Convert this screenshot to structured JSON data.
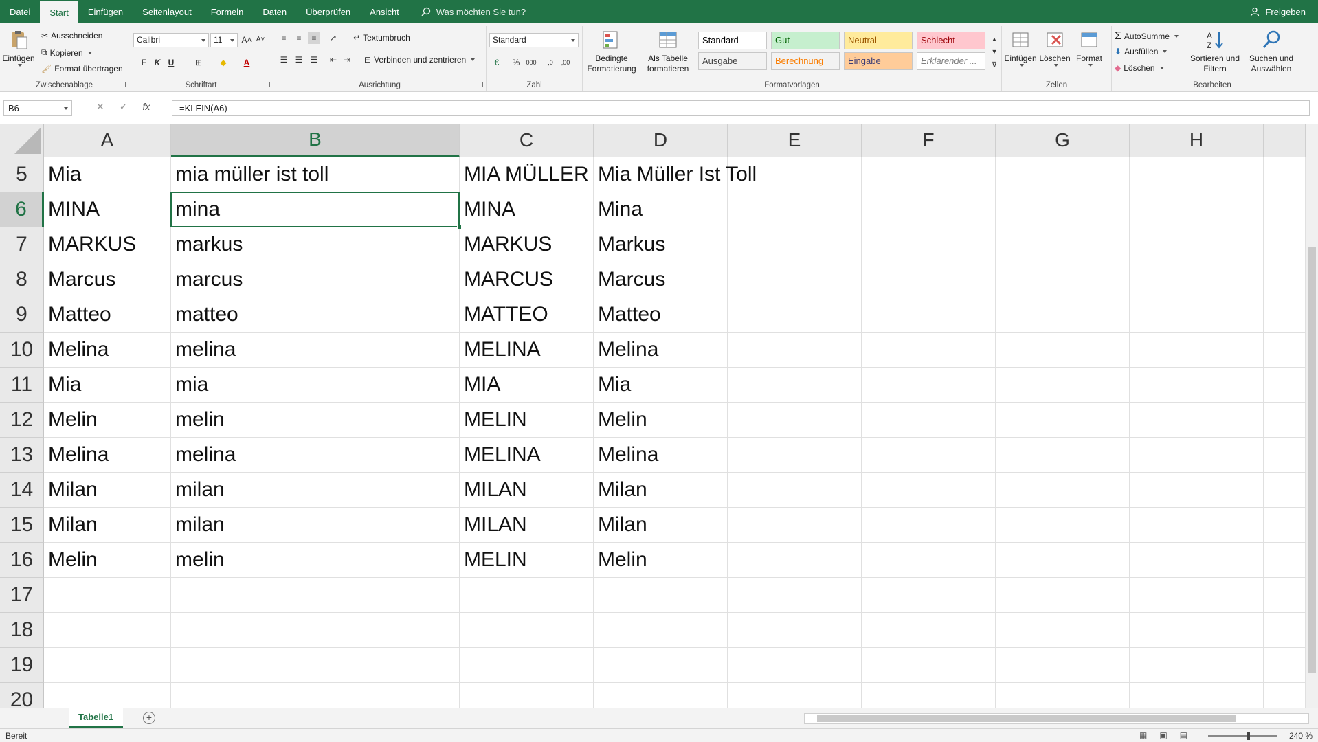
{
  "menu": {
    "tabs": [
      "Datei",
      "Start",
      "Einfügen",
      "Seitenlayout",
      "Formeln",
      "Daten",
      "Überprüfen",
      "Ansicht"
    ],
    "active_tab": "Start",
    "tell_me": "Was möchten Sie tun?",
    "share": "Freigeben"
  },
  "ribbon": {
    "clipboard": {
      "paste": "Einfügen",
      "cut": "Ausschneiden",
      "copy": "Kopieren",
      "format_painter": "Format übertragen",
      "label": "Zwischenablage"
    },
    "font": {
      "name": "Calibri",
      "size": "11",
      "bold": "F",
      "italic": "K",
      "underline": "U",
      "label": "Schriftart"
    },
    "alignment": {
      "wrap": "Textumbruch",
      "merge": "Verbinden und zentrieren",
      "label": "Ausrichtung"
    },
    "number": {
      "format": "Standard",
      "label": "Zahl"
    },
    "styles": {
      "conditional": "Bedingte Formatierung",
      "as_table": "Als Tabelle formatieren",
      "cells": [
        {
          "label": "Standard",
          "bg": "#ffffff",
          "fg": "#000000"
        },
        {
          "label": "Gut",
          "bg": "#c6efce",
          "fg": "#006100"
        },
        {
          "label": "Neutral",
          "bg": "#ffeb9c",
          "fg": "#9c5700"
        },
        {
          "label": "Schlecht",
          "bg": "#ffc7ce",
          "fg": "#9c0006"
        },
        {
          "label": "Ausgabe",
          "bg": "#f2f2f2",
          "fg": "#3f3f3f"
        },
        {
          "label": "Berechnung",
          "bg": "#f2f2f2",
          "fg": "#fa7d00"
        },
        {
          "label": "Eingabe",
          "bg": "#ffcc99",
          "fg": "#3f3f76"
        },
        {
          "label": "Erklärender ...",
          "bg": "#ffffff",
          "fg": "#7f7f7f"
        }
      ],
      "label": "Formatvorlagen"
    },
    "cells_group": {
      "insert": "Einfügen",
      "delete": "Löschen",
      "format": "Format",
      "label": "Zellen"
    },
    "editing": {
      "autosum": "AutoSumme",
      "fill": "Ausfüllen",
      "clear": "Löschen",
      "sort": "Sortieren und Filtern",
      "find": "Suchen und Auswählen",
      "label": "Bearbeiten"
    }
  },
  "formula_bar": {
    "name_box": "B6",
    "formula": "=KLEIN(A6)"
  },
  "grid": {
    "columns": [
      "A",
      "B",
      "C",
      "D",
      "E",
      "F",
      "G",
      "H"
    ],
    "selected_column": "B",
    "selected_row": "6",
    "rows": [
      {
        "num": "5",
        "cells": [
          "Mia",
          "mia müller ist toll",
          "MIA MÜLLER",
          "Mia Müller Ist Toll",
          "",
          "",
          "",
          ""
        ]
      },
      {
        "num": "6",
        "cells": [
          "MINA",
          "mina",
          "MINA",
          "Mina",
          "",
          "",
          "",
          ""
        ]
      },
      {
        "num": "7",
        "cells": [
          "MARKUS",
          "markus",
          "MARKUS",
          "Markus",
          "",
          "",
          "",
          ""
        ]
      },
      {
        "num": "8",
        "cells": [
          "Marcus",
          "marcus",
          "MARCUS",
          "Marcus",
          "",
          "",
          "",
          ""
        ]
      },
      {
        "num": "9",
        "cells": [
          "Matteo",
          "matteo",
          "MATTEO",
          "Matteo",
          "",
          "",
          "",
          ""
        ]
      },
      {
        "num": "10",
        "cells": [
          "Melina",
          "melina",
          "MELINA",
          "Melina",
          "",
          "",
          "",
          ""
        ]
      },
      {
        "num": "11",
        "cells": [
          "Mia",
          "mia",
          "MIA",
          "Mia",
          "",
          "",
          "",
          ""
        ]
      },
      {
        "num": "12",
        "cells": [
          "Melin",
          "melin",
          "MELIN",
          "Melin",
          "",
          "",
          "",
          ""
        ]
      },
      {
        "num": "13",
        "cells": [
          "Melina",
          "melina",
          "MELINA",
          "Melina",
          "",
          "",
          "",
          ""
        ]
      },
      {
        "num": "14",
        "cells": [
          "Milan",
          "milan",
          "MILAN",
          "Milan",
          "",
          "",
          "",
          ""
        ]
      },
      {
        "num": "15",
        "cells": [
          "Milan",
          "milan",
          "MILAN",
          "Milan",
          "",
          "",
          "",
          ""
        ]
      },
      {
        "num": "16",
        "cells": [
          "Melin",
          "melin",
          "MELIN",
          "Melin",
          "",
          "",
          "",
          ""
        ]
      },
      {
        "num": "17",
        "cells": [
          "",
          "",
          "",
          "",
          "",
          "",
          "",
          ""
        ]
      },
      {
        "num": "18",
        "cells": [
          "",
          "",
          "",
          "",
          "",
          "",
          "",
          ""
        ]
      },
      {
        "num": "19",
        "cells": [
          "",
          "",
          "",
          "",
          "",
          "",
          "",
          ""
        ]
      },
      {
        "num": "20",
        "cells": [
          "",
          "",
          "",
          "",
          "",
          "",
          "",
          ""
        ]
      }
    ]
  },
  "sheets": {
    "active": "Tabelle1"
  },
  "status": {
    "mode": "Bereit",
    "zoom": "240 %",
    "zoom_level_percent": 240
  },
  "colors": {
    "accent": "#217346"
  }
}
